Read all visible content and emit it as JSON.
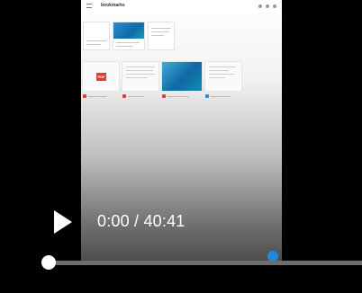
{
  "player": {
    "current_time": "0:00",
    "separator": " / ",
    "duration": "40:41",
    "progress_fraction": 0,
    "play_icon": "play-icon"
  },
  "screen": {
    "app_logo": "bookmarks",
    "accent_color": "#1e88e5",
    "pdf_color": "#e53935",
    "pdf_label": "PDF"
  }
}
